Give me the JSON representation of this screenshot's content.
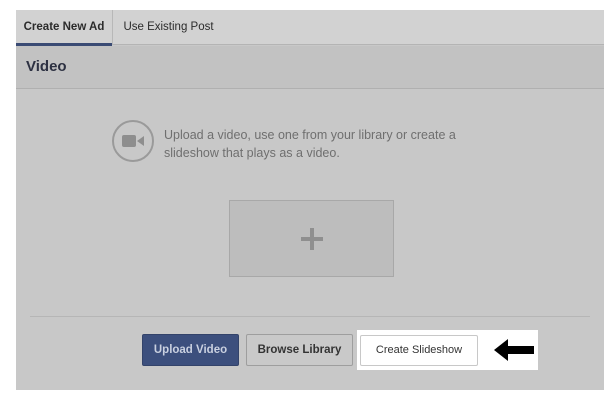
{
  "tabs": [
    {
      "label": "Create New Ad",
      "active": true
    },
    {
      "label": "Use Existing Post",
      "active": false
    }
  ],
  "section": {
    "title": "Video"
  },
  "upload": {
    "description_line1": "Upload a video, use one from your library or create a",
    "description_line2": "slideshow that plays as a video.",
    "camera_icon": "video-camera-icon",
    "dropzone_icon": "plus-icon"
  },
  "actions": {
    "upload_video": "Upload Video",
    "browse_library": "Browse Library",
    "create_slideshow": "Create Slideshow"
  },
  "annotation": {
    "arrow_icon": "arrow-left-icon"
  },
  "colors": {
    "primary_button": "#3c4f7d",
    "tab_underline": "#3a4b74",
    "overlay": "#c8c8c8",
    "highlight": "#ffffff"
  }
}
